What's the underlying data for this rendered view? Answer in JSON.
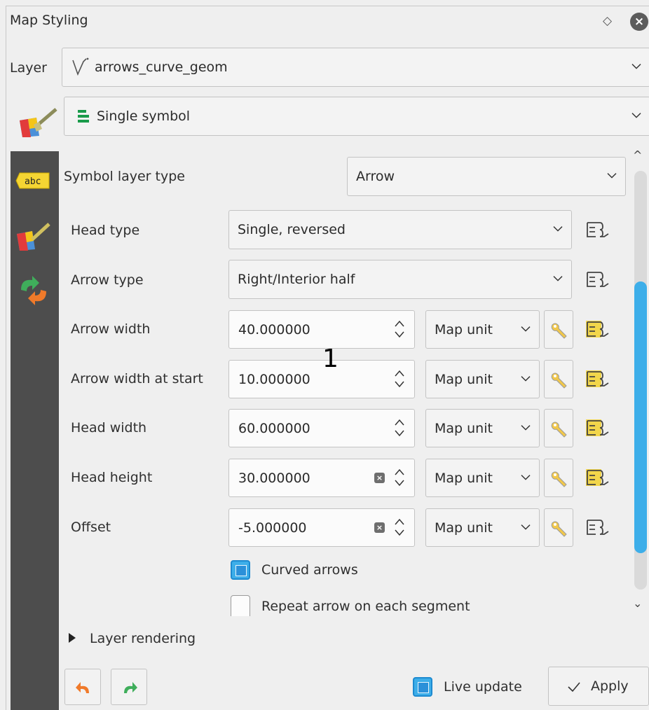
{
  "panel": {
    "title": "Map Styling"
  },
  "layer": {
    "label": "Layer",
    "value": "arrows_curve_geom"
  },
  "renderer": {
    "value": "Single symbol"
  },
  "symbol_layer_type": {
    "label": "Symbol layer type",
    "value": "Arrow"
  },
  "rows": {
    "head_type": {
      "label": "Head type",
      "value": "Single, reversed"
    },
    "arrow_type": {
      "label": "Arrow type",
      "value": "Right/Interior half"
    },
    "arrow_width": {
      "label": "Arrow width",
      "value": "40.000000",
      "unit": "Map unit"
    },
    "arrow_width_start": {
      "label": "Arrow width at start",
      "value": "10.000000",
      "unit": "Map unit"
    },
    "head_width": {
      "label": "Head width",
      "value": "60.000000",
      "unit": "Map unit"
    },
    "head_height": {
      "label": "Head height",
      "value": "30.000000",
      "unit": "Map unit"
    },
    "offset": {
      "label": "Offset",
      "value": "-5.000000",
      "unit": "Map unit"
    }
  },
  "curved_arrows": {
    "label": "Curved arrows",
    "checked": true
  },
  "repeat_arrow": {
    "label": "Repeat arrow on each segment",
    "checked": false
  },
  "layer_rendering": {
    "label": "Layer rendering"
  },
  "live_update": {
    "label": "Live update",
    "checked": true
  },
  "apply": {
    "label": "Apply"
  },
  "marker": {
    "text": "1"
  },
  "icons": {
    "sidebar": [
      "labels-abc-icon",
      "symbology-brush-icon",
      "history-icon"
    ],
    "undo": "undo-icon",
    "redo": "redo-icon",
    "data_defined": "data-defined-override-icon",
    "expression_active": "expression-active-icon",
    "unit_settings": "wrench-icon"
  },
  "colors": {
    "accent": "#3daee9",
    "sidebar": "#4d4d4d",
    "expression_yellow": "#f2d64b"
  }
}
